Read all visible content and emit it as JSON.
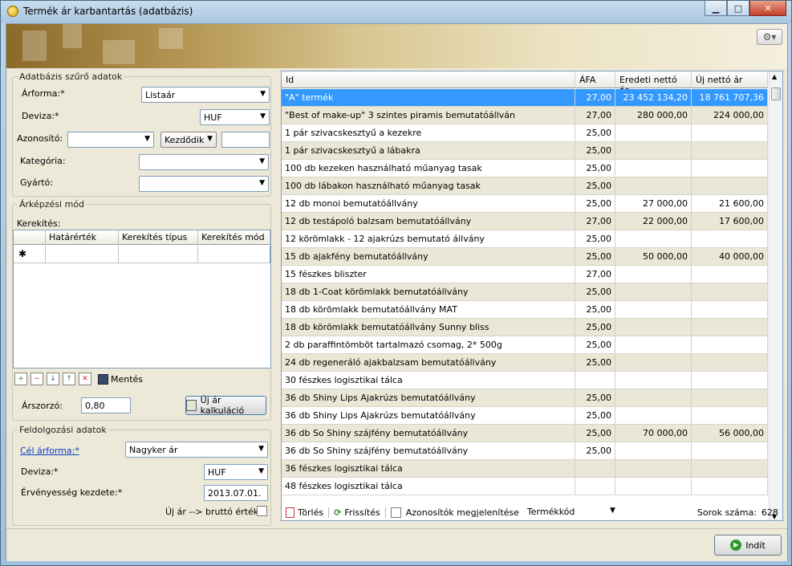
{
  "window": {
    "title": "Termék ár karbantartás (adatbázis)"
  },
  "filter": {
    "title": "Adatbázis szűrő adatok",
    "arforma_label": "Árforma:*",
    "arforma_value": "Listaár",
    "deviza_label": "Deviza:*",
    "deviza_value": "HUF",
    "azonosito_label": "Azonosító:",
    "azonosito_value": "",
    "azonosito_mode": "Kezdődik",
    "azonosito_text": "",
    "kategoria_label": "Kategória:",
    "kategoria_value": "",
    "gyarto_label": "Gyártó:",
    "gyarto_value": ""
  },
  "pricing": {
    "title": "Árképzési mód",
    "kerekites_label": "Kerekítés:",
    "columns": [
      "Határérték",
      "Kerekítés típus",
      "Kerekítés mód"
    ],
    "new_row_marker": "✱",
    "save_label": "Mentés",
    "arszorzo_label": "Árszorzó:",
    "arszorzo_value": "0,80",
    "calc_label": "Új ár kalkuláció"
  },
  "processing": {
    "title": "Feldolgozási adatok",
    "cel_label": "Cél árforma:*",
    "cel_value": "Nagyker ár",
    "deviza_label": "Deviza:*",
    "deviza_value": "HUF",
    "ervenyes_label": "Érvényesség kezdete:*",
    "ervenyes_value": "2013.07.01.",
    "brutto_label": "Új ár --> bruttó érték"
  },
  "table": {
    "columns": [
      "Id",
      "ÁFA",
      "Eredeti nettó ár",
      "Új nettó ár"
    ],
    "rows": [
      [
        "\"A\" termék",
        "27,00",
        "23 452 134,20",
        "18 761 707,36"
      ],
      [
        "\"Best of make-up\" 3 szintes piramis bemutatóállván",
        "27,00",
        "280 000,00",
        "224 000,00"
      ],
      [
        "1 pár szivacskesztyű a kezekre",
        "25,00",
        "",
        ""
      ],
      [
        "1 pár szivacskesztyű a lábakra",
        "25,00",
        "",
        ""
      ],
      [
        "100 db kezeken használható műanyag tasak",
        "25,00",
        "",
        ""
      ],
      [
        "100 db lábakon használható műanyag tasak",
        "25,00",
        "",
        ""
      ],
      [
        "12 db monoi  bemutatóállvány",
        "25,00",
        "27 000,00",
        "21 600,00"
      ],
      [
        "12 db testápoló balzsam  bemutatóállvány",
        "27,00",
        "22 000,00",
        "17 600,00"
      ],
      [
        "12 körömlakk - 12 ajakrúzs bemutató állvány",
        "25,00",
        "",
        ""
      ],
      [
        "15 db ajakfény bemutatóállvány",
        "25,00",
        "50 000,00",
        "40 000,00"
      ],
      [
        "15 fészkes bliszter",
        "27,00",
        "",
        ""
      ],
      [
        "18 db 1-Coat körömlakk bemutatóállvány",
        "25,00",
        "",
        ""
      ],
      [
        "18 db körömlakk bemutatóállvány MAT",
        "25,00",
        "",
        ""
      ],
      [
        "18 db körömlakk bemutatóállvány Sunny bliss",
        "25,00",
        "",
        ""
      ],
      [
        "2 db paraffintömböt tartalmazó csomag, 2* 500g",
        "25,00",
        "",
        ""
      ],
      [
        "24 db regeneráló ajakbalzsam bemutatóállvány",
        "25,00",
        "",
        ""
      ],
      [
        "30 fészkes logisztikai tálca",
        "",
        "",
        ""
      ],
      [
        "36 db Shiny Lips Ajakrúzs bemutatóállvány",
        "25,00",
        "",
        ""
      ],
      [
        "36 db Shiny Lips Ajakrúzs bemutatóállvány",
        "25,00",
        "",
        ""
      ],
      [
        "36 db So Shiny szájfény bemutatóállvány",
        "25,00",
        "70 000,00",
        "56 000,00"
      ],
      [
        "36 db So Shiny szájfény bemutatóállvány",
        "25,00",
        "",
        ""
      ],
      [
        "36 fészkes logisztikai tálca",
        "",
        "",
        ""
      ],
      [
        "48 fészkes logisztikai tálca",
        "",
        "",
        ""
      ]
    ]
  },
  "status": {
    "delete_label": "Törlés",
    "refresh_label": "Frissítés",
    "show_ids_label": "Azonosítók megjelenítése",
    "id_mode_value": "Termékkód",
    "rows_label": "Sorok száma:",
    "rows_value": "628"
  },
  "bottom": {
    "start_label": "Indít"
  }
}
